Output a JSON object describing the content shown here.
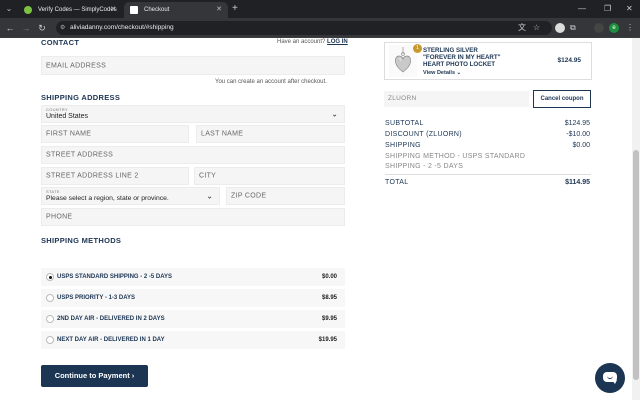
{
  "browser": {
    "tabs": [
      {
        "title": "Verify Codes — SimplyCodes",
        "active": false,
        "favicon_color": "#7cc242"
      },
      {
        "title": "Checkout",
        "active": true,
        "favicon_color": "#ffffff"
      }
    ],
    "url": "aliviadanny.com/checkout/#shipping",
    "new_tab_icon": "plus-icon",
    "profile_initial": "e"
  },
  "contact": {
    "title": "CONTACT",
    "have_account": "Have an account?",
    "login_label": "LOG IN",
    "email_placeholder": "EMAIL ADDRESS",
    "create_account_note": "You can create an account after checkout."
  },
  "shipping_address": {
    "title": "SHIPPING ADDRESS",
    "country_label": "COUNTRY",
    "country_value": "United States",
    "first_name": "FIRST NAME",
    "last_name": "LAST NAME",
    "street": "STREET ADDRESS",
    "street2": "STREET ADDRESS LINE 2",
    "city": "CITY",
    "state_label": "STATE",
    "state_value": "Please select a region, state or province.",
    "zip": "ZIP CODE",
    "phone": "PHONE"
  },
  "shipping_methods": {
    "title": "SHIPPING METHODS",
    "options": [
      {
        "name": "USPS STANDARD SHIPPING - 2 -5 DAYS",
        "price": "$0.00",
        "selected": true
      },
      {
        "name": "USPS PRIORITY - 1-3 DAYS",
        "price": "$8.95",
        "selected": false
      },
      {
        "name": "2ND DAY AIR - DELIVERED IN 2 DAYS",
        "price": "$9.95",
        "selected": false
      },
      {
        "name": "NEXT DAY AIR - DELIVERED IN 1 DAY",
        "price": "$19.95",
        "selected": false
      }
    ]
  },
  "continue_label": "Continue to Payment",
  "order": {
    "product": {
      "name_line1": "STERLING SILVER",
      "name_line2": "\"FOREVER IN MY HEART\"",
      "name_line3": "HEART PHOTO LOCKET",
      "quantity": "1",
      "details_label": "View Details",
      "price": "$124.95"
    },
    "coupon_code": "ZLUORN",
    "cancel_coupon_label": "Cancel coupon",
    "summary": {
      "subtotal_label": "SUBTOTAL",
      "subtotal_value": "$124.95",
      "discount_label": "DISCOUNT (ZLUORN)",
      "discount_value": "-$10.00",
      "shipping_label": "SHIPPING",
      "shipping_value": "$0.00",
      "method_line1": "SHIPPING METHOD - USPS STANDARD",
      "method_line2": "SHIPPING - 2 -5 DAYS",
      "total_label": "TOTAL",
      "total_value": "$114.95"
    }
  },
  "colors": {
    "brand_navy": "#1c3553",
    "field_bg": "#f5f5f5"
  }
}
